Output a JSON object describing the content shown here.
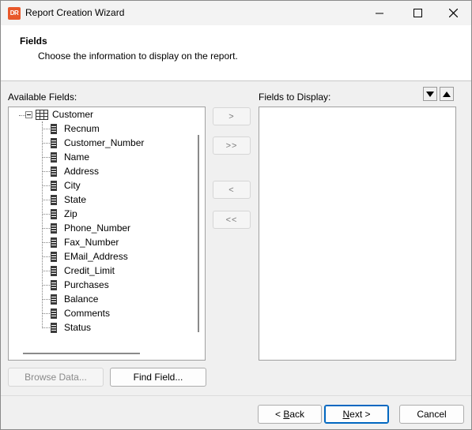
{
  "window": {
    "title": "Report Creation Wizard",
    "app_icon_text": "DR",
    "icon": "dr-app-icon"
  },
  "header": {
    "title": "Fields",
    "subtitle": "Choose the information to display on the report."
  },
  "available": {
    "label": "Available Fields:",
    "table_name": "Customer",
    "fields": [
      "Recnum",
      "Customer_Number",
      "Name",
      "Address",
      "City",
      "State",
      "Zip",
      "Phone_Number",
      "Fax_Number",
      "EMail_Address",
      "Credit_Limit",
      "Purchases",
      "Balance",
      "Comments",
      "Status"
    ]
  },
  "display": {
    "label": "Fields to Display:",
    "fields": []
  },
  "move_buttons": {
    "add": ">",
    "add_all": ">>",
    "remove": "<",
    "remove_all": "<<"
  },
  "bottom": {
    "browse": "Browse Data...",
    "find": "Find Field...",
    "back_pre": "< ",
    "back_accel": "B",
    "back_post": "ack",
    "next_accel": "N",
    "next_post": "ext >",
    "cancel": "Cancel"
  }
}
